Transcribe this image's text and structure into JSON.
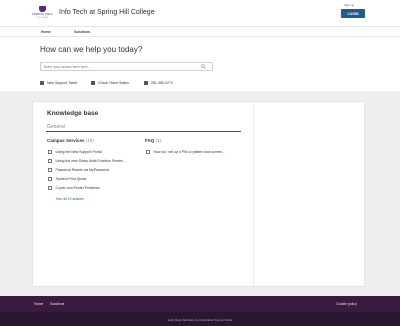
{
  "header": {
    "logo_name": "SPRING HILL",
    "logo_sub": "COLLEGE",
    "title": "Info Tech at Spring Hill College",
    "signup_label": "Sign up",
    "login_label": "LOGIN"
  },
  "nav": {
    "tabs": [
      {
        "label": "Home"
      },
      {
        "label": "Solutions"
      }
    ]
  },
  "hero": {
    "title": "How can we help you today?",
    "search_placeholder": "Enter your search term here...",
    "quick_links": [
      {
        "label": "New Support Ticket",
        "icon": "ticket-icon"
      },
      {
        "label": "Check Ticket Status",
        "icon": "status-icon"
      },
      {
        "label": "251-380-2270",
        "icon": "phone-icon"
      }
    ]
  },
  "kb": {
    "title": "Knowledge base",
    "general_label": "General",
    "categories": [
      {
        "name": "Campus Services",
        "count": "(10)",
        "articles": [
          "Using the New Support Portal",
          "Using the new Sharp Multi-Function Printer/...",
          "Password Resets via MyPassword",
          "Student Print Quota",
          "Copier and Printer Problems"
        ],
        "see_all": "See all 10 articles"
      },
      {
        "name": "FAQ",
        "count": "(1)",
        "articles": [
          "How do I set up a PIN or pattern lock screen..."
        ]
      }
    ]
  },
  "footer": {
    "links": [
      "Home",
      "Solutions"
    ],
    "cookie_label": "Cookie policy",
    "powered_by": "Help Desk Software by Freshdesk Support Desk"
  },
  "colors": {
    "accent": "#1e5e8c",
    "footer_bg": "#3a1a3f",
    "brand": "#5b2a86"
  }
}
